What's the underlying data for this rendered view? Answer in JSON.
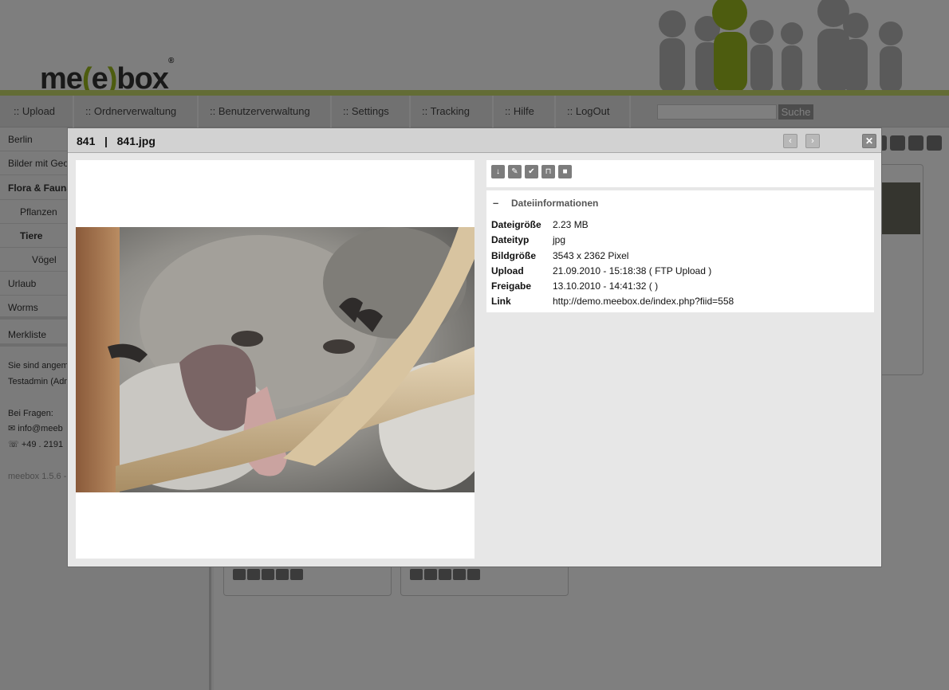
{
  "brand": {
    "logo_part1": "me",
    "logo_bracket_open": "(",
    "logo_part2": "e",
    "logo_bracket_close": ")",
    "logo_part3": "box",
    "logo_mark": "®"
  },
  "nav": {
    "items": [
      {
        "label": ":: Upload"
      },
      {
        "label": ":: Ordnerverwaltung"
      },
      {
        "label": ":: Benutzerverwaltung"
      },
      {
        "label": ":: Settings"
      },
      {
        "label": ":: Tracking"
      },
      {
        "label": ":: Hilfe"
      },
      {
        "label": ":: LogOut"
      }
    ],
    "search_placeholder": "",
    "search_button": "Suche"
  },
  "sidebar": {
    "folders": [
      {
        "label": "Berlin"
      },
      {
        "label": "Bilder mit Geo"
      },
      {
        "label": "Flora & Fauna"
      },
      {
        "label": "Pflanzen"
      },
      {
        "label": "Tiere"
      },
      {
        "label": "Vögel"
      },
      {
        "label": "Urlaub"
      },
      {
        "label": "Worms"
      }
    ],
    "watchlist": "Merkliste",
    "login_line1": "Sie sind angem",
    "login_line2": "Testadmin (Adm",
    "questions_label": "Bei Fragen:",
    "email": "info@meeb",
    "phone": "+49 . 2191",
    "version": "meebox 1.5.6 -"
  },
  "modal": {
    "file_id": "841",
    "separator": "|",
    "file_name": "841.jpg",
    "prev_icon": "chevron-left-icon",
    "next_icon": "chevron-right-icon",
    "close_glyph": "✕",
    "info_toggle": "–",
    "info_heading": "Dateiinformationen",
    "info_rows": [
      {
        "label": "Dateigröße",
        "value": "2.23 MB"
      },
      {
        "label": "Dateityp",
        "value": "jpg"
      },
      {
        "label": "Bildgröße",
        "value": "3543 x 2362 Pixel"
      },
      {
        "label": "Upload",
        "value": "21.09.2010 - 15:18:38 ( FTP Upload )"
      },
      {
        "label": "Freigabe",
        "value": "13.10.2010 - 14:41:32 ( )"
      },
      {
        "label": "Link",
        "value": "http://demo.meebox.de/index.php?fiid=558"
      }
    ],
    "tools": [
      {
        "icon": "download-icon",
        "glyph": "↓"
      },
      {
        "icon": "edit-icon",
        "glyph": "✎"
      },
      {
        "icon": "approve-icon",
        "glyph": "✔"
      },
      {
        "icon": "unlock-icon",
        "glyph": "⊓"
      },
      {
        "icon": "delete-icon",
        "glyph": "■"
      }
    ]
  },
  "colors": {
    "accent": "#9ab81e",
    "overlay": "#808080"
  }
}
